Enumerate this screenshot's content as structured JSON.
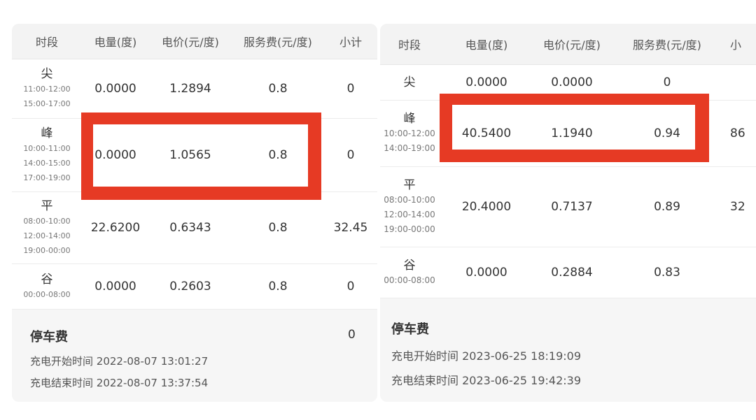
{
  "tables": [
    {
      "headers": [
        "时段",
        "电量(度)",
        "电价(元/度)",
        "服务费(元/度)",
        "小计"
      ],
      "rows": [
        {
          "period": "尖",
          "ranges": [
            "11:00-12:00",
            "15:00-17:00"
          ],
          "kwh": "0.0000",
          "price": "1.2894",
          "service": "0.8",
          "subtotal": "0"
        },
        {
          "period": "峰",
          "ranges": [
            "10:00-11:00",
            "14:00-15:00",
            "17:00-19:00"
          ],
          "kwh": "0.0000",
          "price": "1.0565",
          "service": "0.8",
          "subtotal": "0"
        },
        {
          "period": "平",
          "ranges": [
            "08:00-10:00",
            "12:00-14:00",
            "19:00-00:00"
          ],
          "kwh": "22.6200",
          "price": "0.6343",
          "service": "0.8",
          "subtotal": "32.45"
        },
        {
          "period": "谷",
          "ranges": [
            "00:00-08:00"
          ],
          "kwh": "0.0000",
          "price": "0.2603",
          "service": "0.8",
          "subtotal": "0"
        }
      ],
      "parking": {
        "label": "停车费",
        "value": "0"
      },
      "start": {
        "label": "充电开始时间",
        "value": "2022-08-07 13:01:27"
      },
      "end": {
        "label": "充电结束时间",
        "value": "2022-08-07 13:37:54"
      }
    },
    {
      "headers": [
        "时段",
        "电量(度)",
        "电价(元/度)",
        "服务费(元/度)",
        "小"
      ],
      "rows": [
        {
          "period": "尖",
          "ranges": [],
          "kwh": "0.0000",
          "price": "0.0000",
          "service": "0",
          "subtotal": ""
        },
        {
          "period": "峰",
          "ranges": [
            "10:00-12:00",
            "14:00-19:00"
          ],
          "kwh": "40.5400",
          "price": "1.1940",
          "service": "0.94",
          "subtotal": "86"
        },
        {
          "period": "平",
          "ranges": [
            "08:00-10:00",
            "12:00-14:00",
            "19:00-00:00"
          ],
          "kwh": "20.4000",
          "price": "0.7137",
          "service": "0.89",
          "subtotal": "32"
        },
        {
          "period": "谷",
          "ranges": [
            "00:00-08:00"
          ],
          "kwh": "0.0000",
          "price": "0.2884",
          "service": "0.83",
          "subtotal": ""
        }
      ],
      "parking": {
        "label": "停车费",
        "value": ""
      },
      "start": {
        "label": "充电开始时间",
        "value": "2023-06-25 18:19:09"
      },
      "end": {
        "label": "充电结束时间",
        "value": "2023-06-25 19:42:39"
      }
    }
  ],
  "colors": {
    "highlight": "#e63a24",
    "panel_bg": "#f6f6f6",
    "row_bg": "#ffffff"
  }
}
